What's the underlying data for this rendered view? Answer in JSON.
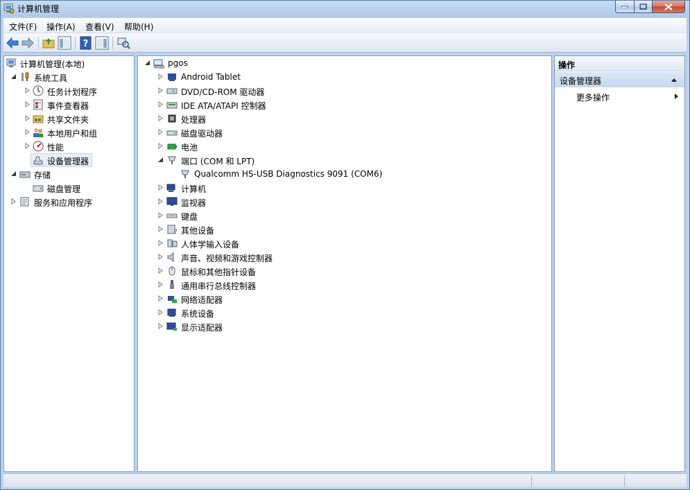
{
  "window": {
    "title": "计算机管理"
  },
  "menu": [
    {
      "label": "文件(F)"
    },
    {
      "label": "操作(A)"
    },
    {
      "label": "查看(V)"
    },
    {
      "label": "帮助(H)"
    }
  ],
  "left_tree": {
    "root": "计算机管理(本地)",
    "system_tools": "系统工具",
    "task_scheduler": "任务计划程序",
    "event_viewer": "事件查看器",
    "shared_folders": "共享文件夹",
    "local_users": "本地用户和组",
    "performance": "性能",
    "device_manager": "设备管理器",
    "storage": "存储",
    "disk_management": "磁盘管理",
    "services_apps": "服务和应用程序"
  },
  "device_tree": {
    "root": "pgos",
    "categories": [
      "Android Tablet",
      "DVD/CD-ROM 驱动器",
      "IDE ATA/ATAPI 控制器",
      "处理器",
      "磁盘驱动器",
      "电池",
      "端口 (COM 和 LPT)",
      "Qualcomm HS-USB Diagnostics 9091 (COM6)",
      "计算机",
      "监视器",
      "键盘",
      "其他设备",
      "人体学输入设备",
      "声音、视频和游戏控制器",
      "鼠标和其他指针设备",
      "通用串行总线控制器",
      "网络适配器",
      "系统设备",
      "显示适配器"
    ]
  },
  "actions": {
    "header": "操作",
    "section": "设备管理器",
    "more": "更多操作"
  }
}
